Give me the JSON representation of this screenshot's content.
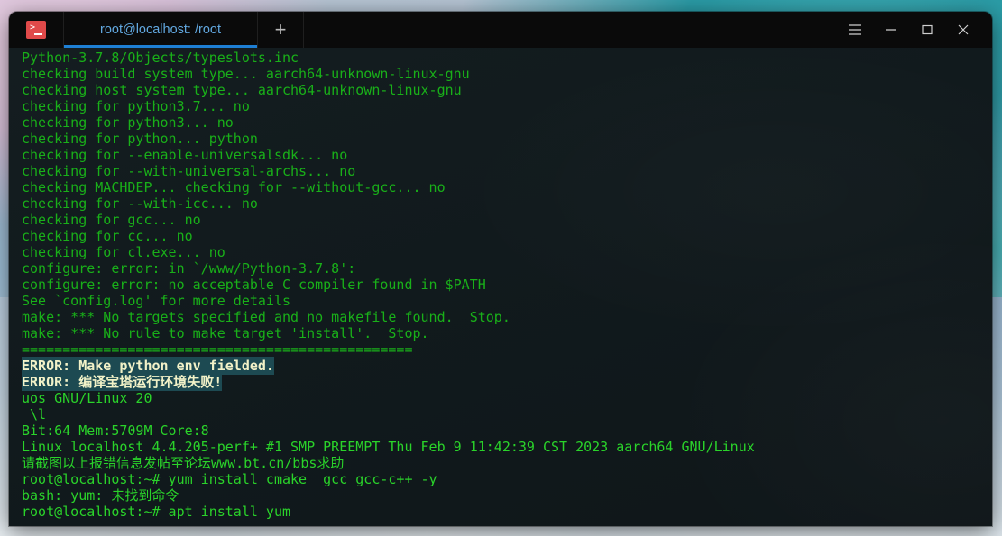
{
  "window": {
    "app_icon": "terminal-prompt-icon",
    "tabs": [
      {
        "label": "root@localhost: /root",
        "active": true
      }
    ],
    "new_tab_label": "+",
    "controls": {
      "menu": "hamburger-menu-icon",
      "minimize": "minimize-icon",
      "maximize": "maximize-icon",
      "close": "close-icon"
    }
  },
  "terminal": {
    "lines": [
      {
        "text": "Python-3.7.8/Objects/typeslots.inc",
        "style": "normal"
      },
      {
        "text": "checking build system type... aarch64-unknown-linux-gnu",
        "style": "normal"
      },
      {
        "text": "checking host system type... aarch64-unknown-linux-gnu",
        "style": "normal"
      },
      {
        "text": "checking for python3.7... no",
        "style": "normal"
      },
      {
        "text": "checking for python3... no",
        "style": "normal"
      },
      {
        "text": "checking for python... python",
        "style": "normal"
      },
      {
        "text": "checking for --enable-universalsdk... no",
        "style": "normal"
      },
      {
        "text": "checking for --with-universal-archs... no",
        "style": "normal"
      },
      {
        "text": "checking MACHDEP... checking for --without-gcc... no",
        "style": "normal"
      },
      {
        "text": "checking for --with-icc... no",
        "style": "normal"
      },
      {
        "text": "checking for gcc... no",
        "style": "normal"
      },
      {
        "text": "checking for cc... no",
        "style": "normal"
      },
      {
        "text": "checking for cl.exe... no",
        "style": "normal"
      },
      {
        "text": "configure: error: in `/www/Python-3.7.8':",
        "style": "normal"
      },
      {
        "text": "configure: error: no acceptable C compiler found in $PATH",
        "style": "normal"
      },
      {
        "text": "See `config.log' for more details",
        "style": "normal"
      },
      {
        "text": "make: *** No targets specified and no makefile found.  Stop.",
        "style": "normal"
      },
      {
        "text": "make: *** No rule to make target 'install'.  Stop.",
        "style": "normal"
      },
      {
        "text": "================================================",
        "style": "normal"
      },
      {
        "text": "ERROR: Make python env fielded.",
        "style": "selected"
      },
      {
        "text": "ERROR: 编译宝塔运行环境失败!",
        "style": "selected"
      },
      {
        "text": "uos GNU/Linux 20",
        "style": "bright"
      },
      {
        "text": " \\l",
        "style": "bright"
      },
      {
        "text": "Bit:64 Mem:5709M Core:8",
        "style": "bright"
      },
      {
        "text": "Linux localhost 4.4.205-perf+ #1 SMP PREEMPT Thu Feb 9 11:42:39 CST 2023 aarch64 GNU/Linux",
        "style": "bright"
      },
      {
        "text": "请截图以上报错信息发帖至论坛www.bt.cn/bbs求助",
        "style": "bright"
      },
      {
        "text": "root@localhost:~# yum install cmake  gcc gcc-c++ -y",
        "style": "bright"
      },
      {
        "text": "bash: yum: 未找到命令",
        "style": "bright"
      },
      {
        "text": "root@localhost:~# apt install yum",
        "style": "bright"
      }
    ]
  },
  "colors": {
    "terminal_bg": "#121a1d",
    "titlebar_bg": "#0a0a0a",
    "text_green": "#19b019",
    "text_bright_green": "#2ad32a",
    "selection_bg": "#1d4a52",
    "selection_fg": "#f2f2c8",
    "tab_text": "#62a8e0",
    "tab_underline": "#1e7fd4",
    "app_icon_bg": "#e04a4a"
  }
}
